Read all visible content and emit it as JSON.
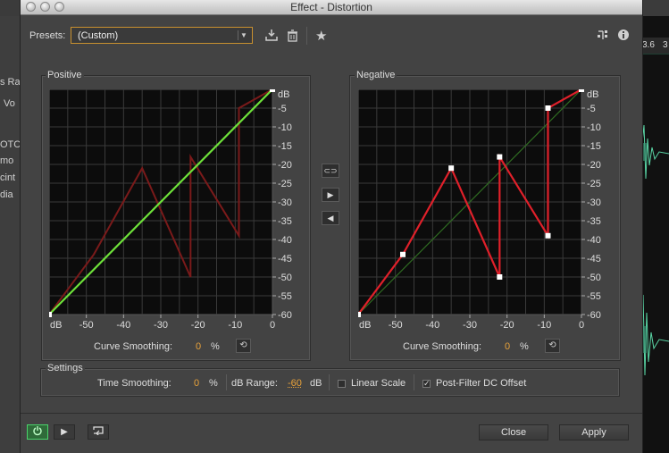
{
  "window": {
    "title": "Effect - Distortion"
  },
  "background": {
    "left_fragments": [
      "s Ra",
      "Vo",
      "OTC",
      "mo",
      "cint",
      "dia"
    ],
    "ruler": {
      "label1": "3.6",
      "label2": "3"
    }
  },
  "presets": {
    "label": "Presets:",
    "value": "(Custom)"
  },
  "icons": {
    "save_preset": "save-preset-icon",
    "delete_preset": "trash-icon",
    "favorite": "star-icon",
    "routing": "routing-icon",
    "info": "info-icon"
  },
  "positive": {
    "title": "Positive",
    "y_unit": "dB",
    "y_ticks": [
      "-5",
      "-10",
      "-15",
      "-20",
      "-25",
      "-30",
      "-35",
      "-40",
      "-45",
      "-50",
      "-55",
      "-60"
    ],
    "x_unit": "dB",
    "x_ticks": [
      "-50",
      "-40",
      "-30",
      "-20",
      "-10",
      "0"
    ],
    "curve_smoothing_label": "Curve Smoothing:",
    "curve_smoothing_value": "0",
    "curve_smoothing_unit": "%"
  },
  "negative": {
    "title": "Negative",
    "y_unit": "dB",
    "y_ticks": [
      "-5",
      "-10",
      "-15",
      "-20",
      "-25",
      "-30",
      "-35",
      "-40",
      "-45",
      "-50",
      "-55",
      "-60"
    ],
    "x_unit": "dB",
    "x_ticks": [
      "-50",
      "-40",
      "-30",
      "-20",
      "-10",
      "0"
    ],
    "curve_smoothing_label": "Curve Smoothing:",
    "curve_smoothing_value": "0",
    "curve_smoothing_unit": "%"
  },
  "curve_points": [
    [
      -60,
      -60
    ],
    [
      -48,
      -44
    ],
    [
      -35,
      -21
    ],
    [
      -22,
      -50
    ],
    [
      -22,
      -18
    ],
    [
      -9,
      -39
    ],
    [
      -9,
      -5
    ],
    [
      0,
      0
    ]
  ],
  "settings": {
    "title": "Settings",
    "time_smoothing_label": "Time Smoothing:",
    "time_smoothing_value": "0",
    "time_smoothing_unit": "%",
    "db_range_label": "dB Range:",
    "db_range_value": "-60",
    "db_range_unit": "dB",
    "linear_scale_label": "Linear Scale",
    "linear_scale_checked": false,
    "post_filter_label": "Post-Filter DC Offset",
    "post_filter_checked": true,
    "post_filter_check": "✓"
  },
  "buttons": {
    "close": "Close",
    "apply": "Apply"
  },
  "colors": {
    "accent": "#e8a23a",
    "curve_active": "#e0202a",
    "curve_dim": "#7a1a1a",
    "diagonal_active": "#6ee23a",
    "diagonal_dim": "#2f6b22",
    "power_on": "#4ad36a"
  }
}
